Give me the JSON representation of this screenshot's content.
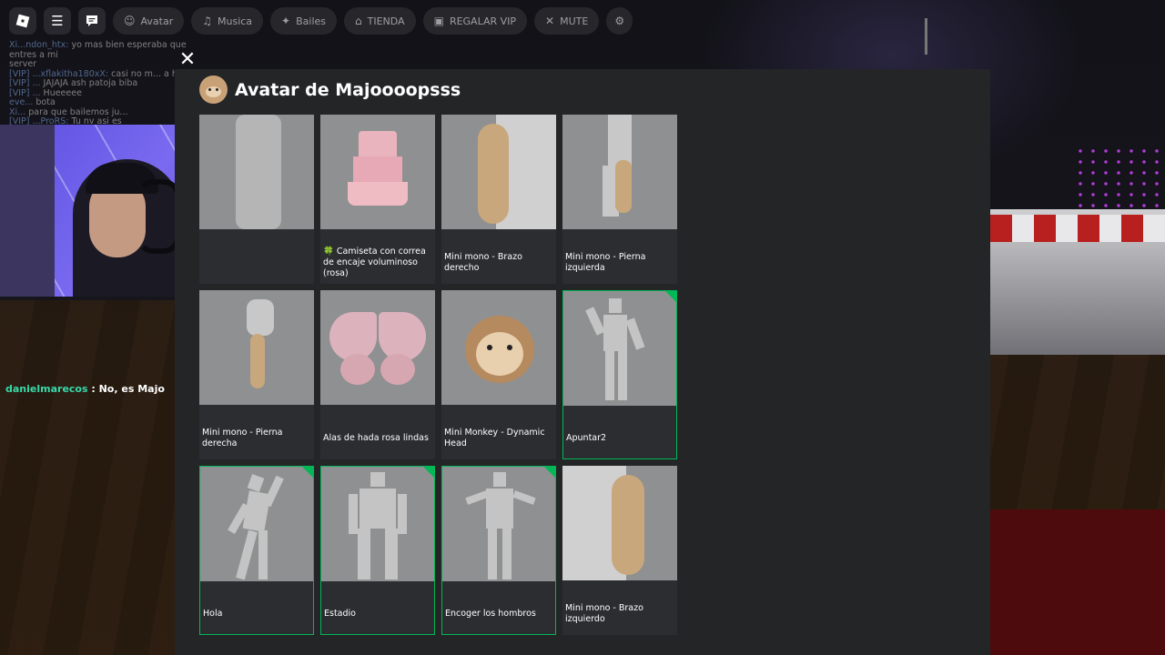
{
  "topbar": {
    "items": [
      {
        "label": "Avatar",
        "icon": "avatar-icon"
      },
      {
        "label": "Musica",
        "icon": "music-icon"
      },
      {
        "label": "Bailes",
        "icon": "dance-icon"
      },
      {
        "label": "TIENDA",
        "icon": "shop-icon"
      },
      {
        "label": "REGALAR VIP",
        "icon": "gift-icon"
      },
      {
        "label": "MUTE",
        "icon": "mute-icon"
      }
    ]
  },
  "chat": {
    "lines": [
      {
        "who": "Xi...ndon_htx:",
        "text": " yo mas bien esperaba que entres a mi"
      },
      {
        "who": "",
        "text": "server"
      },
      {
        "who": "[VIP] ...xflakitha180xX:",
        "text": " casi no m... a hiiii"
      },
      {
        "who": "[VIP] ...",
        "text": " JAJAJA ash patoja biba"
      },
      {
        "who": "[VIP] ...",
        "text": " Hueeeee"
      },
      {
        "who": "eve...",
        "text": " bota"
      },
      {
        "who": "Xi...",
        "text": " para que bailemos ju..."
      },
      {
        "who": "[VIP] ...ProRS:",
        "text": " Tu nv asi es"
      }
    ],
    "highlight_user": "danielmarecos",
    "highlight_text": " : No, es Majo"
  },
  "panel": {
    "title": "Avatar de Majoooopsss",
    "items": [
      {
        "label": "",
        "selected": false
      },
      {
        "label": "Camiseta con correa de encaje voluminoso (rosa)",
        "selected": false,
        "clover": "🍀"
      },
      {
        "label": "Mini mono - Brazo derecho",
        "selected": false
      },
      {
        "label": "Mini mono - Pierna izquierda",
        "selected": false
      },
      {
        "label": "Mini mono - Pierna derecha",
        "selected": false
      },
      {
        "label": "Alas de hada rosa lindas",
        "selected": false
      },
      {
        "label": "Mini Monkey - Dynamic Head",
        "selected": false
      },
      {
        "label": "Apuntar2",
        "selected": true
      },
      {
        "label": "Hola",
        "selected": true
      },
      {
        "label": "Estadio",
        "selected": true
      },
      {
        "label": "Encoger los hombros",
        "selected": true
      },
      {
        "label": "Mini mono - Brazo izquierdo",
        "selected": false
      }
    ]
  },
  "colors": {
    "panel": "#232527",
    "card": "#2b2d30",
    "selected": "#02b757",
    "thumb": "#8f9091"
  }
}
